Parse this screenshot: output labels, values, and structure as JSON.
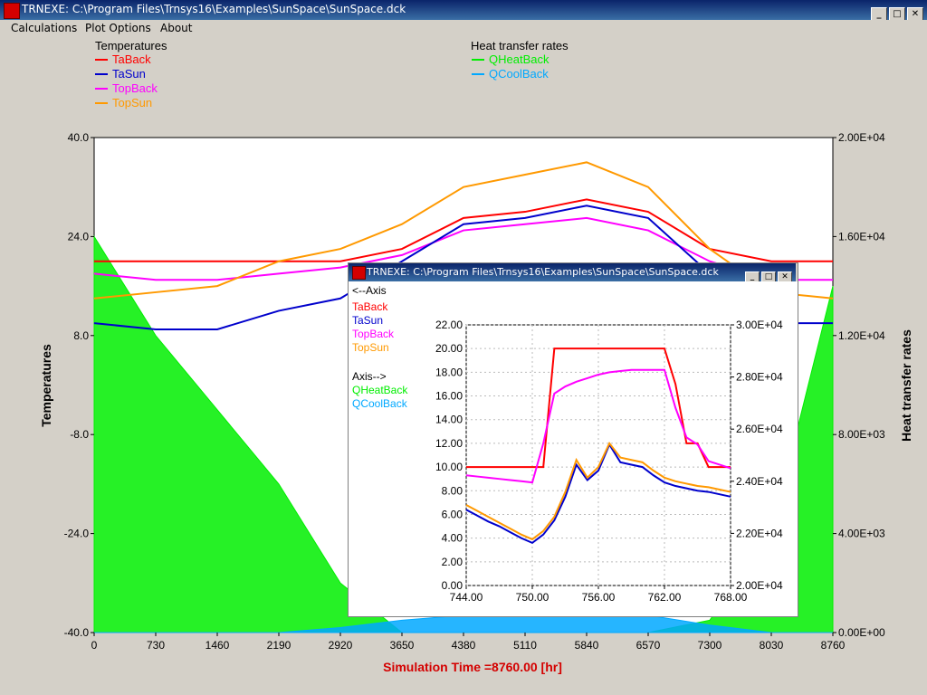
{
  "window": {
    "title": "TRNEXE: C:\\Program Files\\Trnsys16\\Examples\\SunSpace\\SunSpace.dck",
    "buttons": [
      "_",
      "□",
      "✕"
    ]
  },
  "menu": {
    "items": [
      "Calculations",
      "Plot Options",
      "About"
    ]
  },
  "main_plot": {
    "left_group_title": "Temperatures",
    "right_group_title": "Heat transfer rates",
    "left_legend": [
      {
        "name": "TaBack",
        "color": "#ff0000"
      },
      {
        "name": "TaSun",
        "color": "#0000cc"
      },
      {
        "name": "TopBack",
        "color": "#ff00ff"
      },
      {
        "name": "TopSun",
        "color": "#ff9900"
      }
    ],
    "right_legend": [
      {
        "name": "QHeatBack",
        "color": "#00ee00"
      },
      {
        "name": "QCoolBack",
        "color": "#00a8ff"
      }
    ],
    "xlabel": "Simulation Time =8760.00 [hr]",
    "ylabel_left": "Temperatures",
    "ylabel_right": "Heat transfer rates"
  },
  "popup": {
    "title": "TRNEXE: C:\\Program Files\\Trnsys16\\Examples\\SunSpace\\SunSpace.dck",
    "legend_left_axis": "<--Axis",
    "legend_right_axis": "Axis-->",
    "left_items": [
      {
        "name": "TaBack",
        "color": "#ff0000"
      },
      {
        "name": "TaSun",
        "color": "#0000cc"
      },
      {
        "name": "TopBack",
        "color": "#ff00ff"
      },
      {
        "name": "TopSun",
        "color": "#ff9900"
      }
    ],
    "right_items": [
      {
        "name": "QHeatBack",
        "color": "#00ee00"
      },
      {
        "name": "QCoolBack",
        "color": "#00a8ff"
      }
    ]
  },
  "chart_data": [
    {
      "type": "line",
      "x_ticks": [
        "0",
        "730",
        "1460",
        "2190",
        "2920",
        "3650",
        "4380",
        "5110",
        "5840",
        "6570",
        "7300",
        "8030",
        "8760"
      ],
      "xlim": [
        0,
        8760
      ],
      "y_left_ticks": [
        "40.0",
        "24.0",
        "8.0",
        "-8.0",
        "-24.0",
        "-40.0"
      ],
      "ylim_left": [
        -40,
        40
      ],
      "y_right_ticks": [
        "2.00E+04",
        "1.60E+04",
        "1.20E+04",
        "8.00E+03",
        "4.00E+03",
        "0.00E+00"
      ],
      "ylim_right": [
        0,
        20000
      ],
      "series": [
        {
          "name": "TaBack",
          "axis": "left",
          "x": [
            0,
            730,
            1460,
            2190,
            2920,
            3650,
            4380,
            5110,
            5840,
            6570,
            7300,
            8030,
            8760
          ],
          "y": [
            20,
            20,
            20,
            20,
            20,
            22,
            27,
            28,
            30,
            28,
            22,
            20,
            20
          ]
        },
        {
          "name": "TaSun",
          "axis": "left",
          "x": [
            0,
            730,
            1460,
            2190,
            2920,
            3650,
            4380,
            5110,
            5840,
            6570,
            7300,
            8030,
            8760
          ],
          "y": [
            10,
            9,
            9,
            12,
            14,
            20,
            26,
            27,
            29,
            27,
            18,
            10,
            10
          ]
        },
        {
          "name": "TopBack",
          "axis": "left",
          "x": [
            0,
            730,
            1460,
            2190,
            2920,
            3650,
            4380,
            5110,
            5840,
            6570,
            7300,
            8030,
            8760
          ],
          "y": [
            18,
            17,
            17,
            18,
            19,
            21,
            25,
            26,
            27,
            25,
            20,
            17,
            17
          ]
        },
        {
          "name": "TopSun",
          "axis": "left",
          "x": [
            0,
            730,
            1460,
            2190,
            2920,
            3650,
            4380,
            5110,
            5840,
            6570,
            7300,
            8030,
            8760
          ],
          "y": [
            14,
            15,
            16,
            20,
            22,
            26,
            32,
            34,
            36,
            32,
            22,
            15,
            14
          ]
        },
        {
          "name": "QHeatBack",
          "axis": "right",
          "x": [
            0,
            730,
            1460,
            2190,
            2920,
            3650,
            4380,
            5110,
            5840,
            6570,
            7300,
            8030,
            8760
          ],
          "y": [
            16000,
            12000,
            9000,
            6000,
            2000,
            0,
            0,
            0,
            0,
            0,
            500,
            4000,
            14000
          ]
        },
        {
          "name": "QCoolBack",
          "axis": "right",
          "x": [
            0,
            730,
            1460,
            2190,
            2920,
            3650,
            4380,
            5110,
            5840,
            6570,
            7300,
            8030,
            8760
          ],
          "y": [
            0,
            0,
            0,
            0,
            200,
            500,
            700,
            700,
            700,
            700,
            300,
            0,
            0
          ]
        }
      ]
    },
    {
      "type": "line",
      "x_ticks": [
        "744.00",
        "750.00",
        "756.00",
        "762.00",
        "768.00"
      ],
      "xlim": [
        744,
        768
      ],
      "y_left_ticks": [
        "22.00",
        "20.00",
        "18.00",
        "16.00",
        "14.00",
        "12.00",
        "10.00",
        "8.00",
        "6.00",
        "4.00",
        "2.00",
        "0.00"
      ],
      "ylim_left": [
        0,
        22
      ],
      "y_right_ticks": [
        "3.00E+04",
        "2.80E+04",
        "2.60E+04",
        "2.40E+04",
        "2.20E+04",
        "2.00E+04"
      ],
      "ylim_right": [
        20000,
        30000
      ],
      "series": [
        {
          "name": "TaBack",
          "axis": "left",
          "x": [
            744,
            745,
            746,
            747,
            748,
            749,
            750,
            751,
            752,
            753,
            754,
            755,
            756,
            757,
            758,
            759,
            760,
            761,
            762,
            763,
            764,
            765,
            766,
            767,
            768
          ],
          "y": [
            10,
            10,
            10,
            10,
            10,
            10,
            10,
            10,
            20,
            20,
            20,
            20,
            20,
            20,
            20,
            20,
            20,
            20,
            20,
            17,
            12,
            12,
            10,
            10,
            10
          ]
        },
        {
          "name": "TaSun",
          "axis": "left",
          "x": [
            744,
            745,
            746,
            747,
            748,
            749,
            750,
            751,
            752,
            753,
            754,
            755,
            756,
            757,
            758,
            759,
            760,
            761,
            762,
            763,
            764,
            765,
            766,
            767,
            768
          ],
          "y": [
            6.4,
            5.9,
            5.4,
            5.0,
            4.5,
            4.0,
            3.6,
            4.3,
            5.5,
            7.5,
            10.2,
            8.9,
            9.7,
            11.9,
            10.4,
            10.2,
            10.0,
            9.3,
            8.7,
            8.4,
            8.2,
            8.0,
            7.9,
            7.7,
            7.5
          ]
        },
        {
          "name": "TopBack",
          "axis": "left",
          "x": [
            744,
            745,
            746,
            747,
            748,
            749,
            750,
            751,
            752,
            753,
            754,
            755,
            756,
            757,
            758,
            759,
            760,
            761,
            762,
            763,
            764,
            765,
            766,
            767,
            768
          ],
          "y": [
            9.3,
            9.2,
            9.1,
            9.0,
            8.9,
            8.8,
            8.7,
            12.0,
            16.2,
            16.8,
            17.2,
            17.5,
            17.8,
            18.0,
            18.1,
            18.2,
            18.2,
            18.2,
            18.2,
            15.0,
            12.5,
            11.9,
            10.5,
            10.2,
            9.9
          ]
        },
        {
          "name": "TopSun",
          "axis": "left",
          "x": [
            744,
            745,
            746,
            747,
            748,
            749,
            750,
            751,
            752,
            753,
            754,
            755,
            756,
            757,
            758,
            759,
            760,
            761,
            762,
            763,
            764,
            765,
            766,
            767,
            768
          ],
          "y": [
            6.8,
            6.3,
            5.8,
            5.3,
            4.8,
            4.3,
            3.9,
            4.6,
            5.8,
            7.9,
            10.6,
            9.1,
            10.0,
            12.0,
            10.8,
            10.6,
            10.4,
            9.7,
            9.1,
            8.8,
            8.6,
            8.4,
            8.3,
            8.1,
            7.9
          ]
        }
      ]
    }
  ]
}
